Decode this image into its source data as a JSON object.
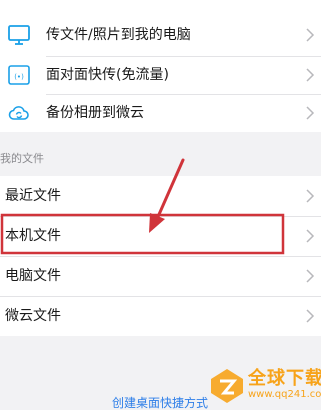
{
  "top_group": {
    "items": [
      {
        "label": "传文件/照片到我的电脑",
        "icon": "monitor-icon"
      },
      {
        "label": "面对面快传(免流量)",
        "icon": "radio-card-icon"
      },
      {
        "label": "备份相册到微云",
        "icon": "cloud-sync-icon"
      }
    ]
  },
  "my_files": {
    "section_title": "我的文件",
    "items": [
      {
        "label": "最近文件"
      },
      {
        "label": "本机文件",
        "highlighted": true
      },
      {
        "label": "电脑文件"
      },
      {
        "label": "微云文件"
      }
    ]
  },
  "footer": {
    "shortcut_link": "创建桌面快捷方式"
  },
  "annotation": {
    "highlight_color": "#d0343a",
    "arrow_color": "#d0343a"
  },
  "watermark": {
    "title": "全球下载",
    "url": "www.qq241.com",
    "color": "#f7a31a"
  },
  "colors": {
    "icon_blue": "#1aa0e8",
    "link_blue": "#2d7ee8",
    "background": "#f2f2f4"
  }
}
